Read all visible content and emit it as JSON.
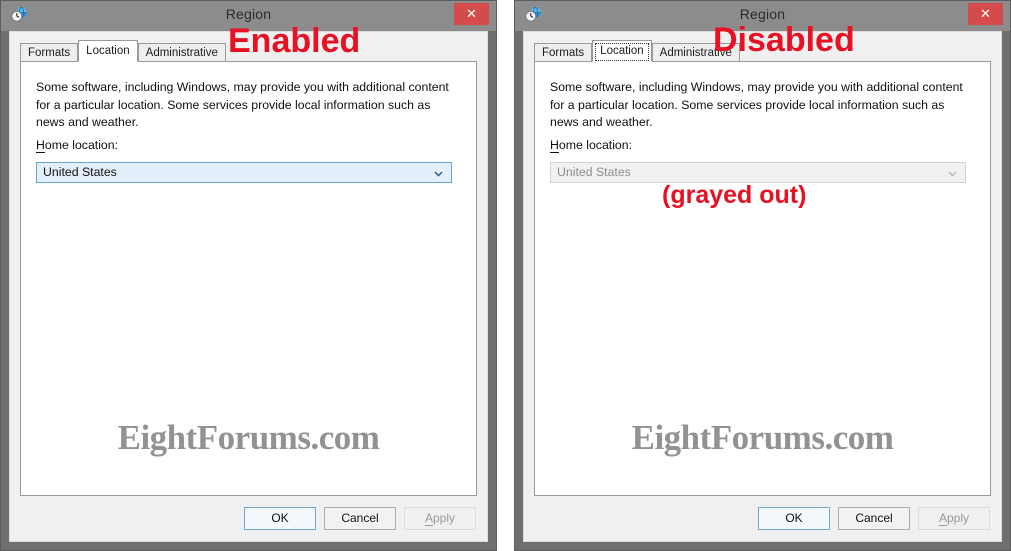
{
  "windows": [
    {
      "id": "left",
      "title": "Region",
      "icon": "region-clock-globe-icon",
      "close_label": "✕",
      "annotation": "Enabled",
      "tabs": [
        {
          "label": "Formats",
          "active": false,
          "focused": false
        },
        {
          "label": "Location",
          "active": true,
          "focused": false
        },
        {
          "label": "Administrative",
          "active": false,
          "focused": false
        }
      ],
      "description": "Some software, including Windows, may provide you with additional content for a particular location. Some services provide local information such as news and weather.",
      "field_label_accel": "H",
      "field_label_rest": "ome location:",
      "combo": {
        "value": "United States",
        "disabled": false,
        "icon": "chevron-down-icon"
      },
      "watermark": "EightForums.com",
      "buttons": [
        {
          "label": "OK",
          "style": "default",
          "disabled": false
        },
        {
          "label": "Cancel",
          "style": "normal",
          "disabled": false
        },
        {
          "label": "Apply",
          "style": "normal",
          "disabled": true,
          "accel": "A",
          "rest": "pply"
        }
      ]
    },
    {
      "id": "right",
      "title": "Region",
      "icon": "region-clock-globe-icon",
      "close_label": "✕",
      "annotation": "Disabled",
      "annotation_secondary": "(grayed out)",
      "tabs": [
        {
          "label": "Formats",
          "active": false,
          "focused": false
        },
        {
          "label": "Location",
          "active": true,
          "focused": true
        },
        {
          "label": "Administrative",
          "active": false,
          "focused": false
        }
      ],
      "description": "Some software, including Windows, may provide you with additional content for a particular location. Some services provide local information such as news and weather.",
      "field_label_accel": "H",
      "field_label_rest": "ome location:",
      "combo": {
        "value": "United States",
        "disabled": true,
        "icon": "chevron-down-icon"
      },
      "watermark": "EightForums.com",
      "buttons": [
        {
          "label": "OK",
          "style": "default",
          "disabled": false
        },
        {
          "label": "Cancel",
          "style": "normal",
          "disabled": false
        },
        {
          "label": "Apply",
          "style": "normal",
          "disabled": true,
          "accel": "A",
          "rest": "pply"
        }
      ]
    }
  ],
  "colors": {
    "titlebar": "#8c8c8c",
    "frame": "#6f6f6f",
    "close_button": "#d44b4b",
    "annotation_red": "#e81123",
    "combo_enabled_bg": "#e3effa",
    "combo_disabled_bg": "#f1f1f1",
    "watermark_gray": "#808080"
  }
}
